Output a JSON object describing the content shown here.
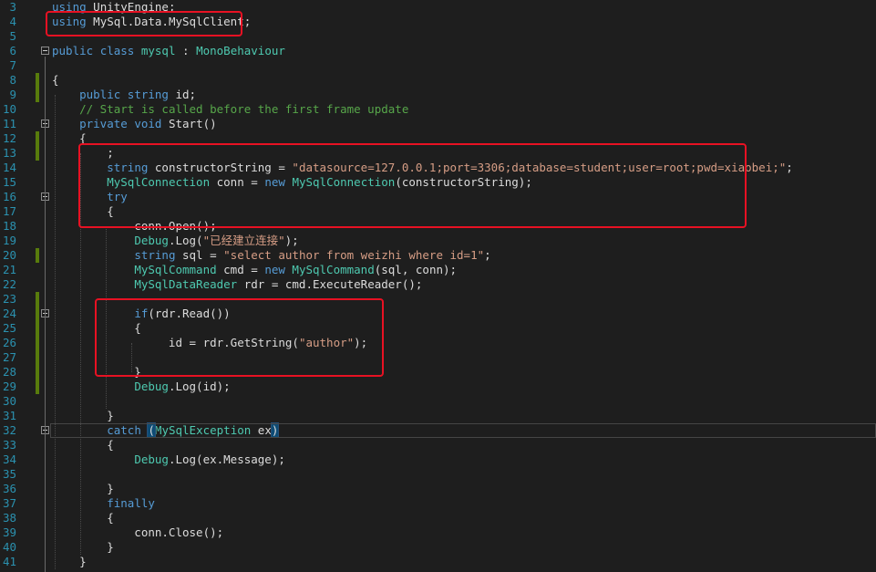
{
  "editor": {
    "lines": [
      {
        "n": "3",
        "segs": [
          {
            "c": "kw",
            "t": "using"
          },
          {
            "c": "txt",
            "t": " UnityEngine;"
          }
        ]
      },
      {
        "n": "4",
        "segs": [
          {
            "c": "kw",
            "t": "using"
          },
          {
            "c": "txt",
            "t": " MySql.Data.MySqlClient;"
          }
        ]
      },
      {
        "n": "5",
        "segs": []
      },
      {
        "n": "6",
        "segs": [
          {
            "c": "kw",
            "t": "public"
          },
          {
            "c": "txt",
            "t": " "
          },
          {
            "c": "kw",
            "t": "class"
          },
          {
            "c": "txt",
            "t": " "
          },
          {
            "c": "ty",
            "t": "mysql"
          },
          {
            "c": "txt",
            "t": " : "
          },
          {
            "c": "ty",
            "t": "MonoBehaviour"
          }
        ]
      },
      {
        "n": "7",
        "segs": []
      },
      {
        "n": "8",
        "segs": [
          {
            "c": "txt",
            "t": "{"
          }
        ]
      },
      {
        "n": "9",
        "segs": [
          {
            "c": "txt",
            "t": "    "
          },
          {
            "c": "kw",
            "t": "public"
          },
          {
            "c": "txt",
            "t": " "
          },
          {
            "c": "kw",
            "t": "string"
          },
          {
            "c": "txt",
            "t": " id;"
          }
        ]
      },
      {
        "n": "10",
        "segs": [
          {
            "c": "txt",
            "t": "    "
          },
          {
            "c": "cm",
            "t": "// Start is called before the first frame update"
          }
        ]
      },
      {
        "n": "11",
        "segs": [
          {
            "c": "txt",
            "t": "    "
          },
          {
            "c": "kw",
            "t": "private"
          },
          {
            "c": "txt",
            "t": " "
          },
          {
            "c": "kw",
            "t": "void"
          },
          {
            "c": "txt",
            "t": " Start()"
          }
        ]
      },
      {
        "n": "12",
        "segs": [
          {
            "c": "txt",
            "t": "    {"
          }
        ]
      },
      {
        "n": "13",
        "segs": [
          {
            "c": "txt",
            "t": "        ;"
          }
        ]
      },
      {
        "n": "14",
        "segs": [
          {
            "c": "txt",
            "t": "        "
          },
          {
            "c": "kw",
            "t": "string"
          },
          {
            "c": "txt",
            "t": " constructorString = "
          },
          {
            "c": "str",
            "t": "\"datasource=127.0.0.1;port=3306;database=student;user=root;pwd=xiaobei;\""
          },
          {
            "c": "txt",
            "t": ";"
          }
        ]
      },
      {
        "n": "15",
        "segs": [
          {
            "c": "txt",
            "t": "        "
          },
          {
            "c": "ty",
            "t": "MySqlConnection"
          },
          {
            "c": "txt",
            "t": " conn = "
          },
          {
            "c": "kw",
            "t": "new"
          },
          {
            "c": "txt",
            "t": " "
          },
          {
            "c": "ty",
            "t": "MySqlConnection"
          },
          {
            "c": "txt",
            "t": "(constructorString);"
          }
        ]
      },
      {
        "n": "16",
        "segs": [
          {
            "c": "txt",
            "t": "        "
          },
          {
            "c": "kw",
            "t": "try"
          }
        ]
      },
      {
        "n": "17",
        "segs": [
          {
            "c": "txt",
            "t": "        {"
          }
        ]
      },
      {
        "n": "18",
        "segs": [
          {
            "c": "txt",
            "t": "            conn.Open();"
          }
        ]
      },
      {
        "n": "19",
        "segs": [
          {
            "c": "txt",
            "t": "            "
          },
          {
            "c": "ty",
            "t": "Debug"
          },
          {
            "c": "txt",
            "t": ".Log("
          },
          {
            "c": "str",
            "t": "\"已经建立连接\""
          },
          {
            "c": "txt",
            "t": ");"
          }
        ]
      },
      {
        "n": "20",
        "segs": [
          {
            "c": "txt",
            "t": "            "
          },
          {
            "c": "kw",
            "t": "string"
          },
          {
            "c": "txt",
            "t": " sql = "
          },
          {
            "c": "str",
            "t": "\"select author from weizhi where id=1\""
          },
          {
            "c": "txt",
            "t": ";"
          }
        ]
      },
      {
        "n": "21",
        "segs": [
          {
            "c": "txt",
            "t": "            "
          },
          {
            "c": "ty",
            "t": "MySqlCommand"
          },
          {
            "c": "txt",
            "t": " cmd = "
          },
          {
            "c": "kw",
            "t": "new"
          },
          {
            "c": "txt",
            "t": " "
          },
          {
            "c": "ty",
            "t": "MySqlCommand"
          },
          {
            "c": "txt",
            "t": "(sql, conn);"
          }
        ]
      },
      {
        "n": "22",
        "segs": [
          {
            "c": "txt",
            "t": "            "
          },
          {
            "c": "ty",
            "t": "MySqlDataReader"
          },
          {
            "c": "txt",
            "t": " rdr = cmd.ExecuteReader();"
          }
        ]
      },
      {
        "n": "23",
        "segs": []
      },
      {
        "n": "24",
        "segs": [
          {
            "c": "txt",
            "t": "            "
          },
          {
            "c": "kw",
            "t": "if"
          },
          {
            "c": "txt",
            "t": "(rdr.Read())"
          }
        ]
      },
      {
        "n": "25",
        "segs": [
          {
            "c": "txt",
            "t": "            {"
          }
        ]
      },
      {
        "n": "26",
        "segs": [
          {
            "c": "txt",
            "t": "                 id = rdr.GetString("
          },
          {
            "c": "str",
            "t": "\"author\""
          },
          {
            "c": "txt",
            "t": ");"
          }
        ]
      },
      {
        "n": "27",
        "segs": []
      },
      {
        "n": "28",
        "segs": [
          {
            "c": "txt",
            "t": "            }"
          }
        ]
      },
      {
        "n": "29",
        "segs": [
          {
            "c": "txt",
            "t": "            "
          },
          {
            "c": "ty",
            "t": "Debug"
          },
          {
            "c": "txt",
            "t": ".Log(id);"
          }
        ]
      },
      {
        "n": "30",
        "segs": []
      },
      {
        "n": "31",
        "segs": [
          {
            "c": "txt",
            "t": "        }"
          }
        ]
      },
      {
        "n": "32",
        "segs": [
          {
            "c": "txt",
            "t": "        "
          },
          {
            "c": "kw",
            "t": "catch"
          },
          {
            "c": "txt",
            "t": " "
          },
          {
            "c": "hl",
            "t": "("
          },
          {
            "c": "ty",
            "t": "MySqlException"
          },
          {
            "c": "txt",
            "t": " ex"
          },
          {
            "c": "hl",
            "t": ")"
          }
        ]
      },
      {
        "n": "33",
        "segs": [
          {
            "c": "txt",
            "t": "        {"
          }
        ]
      },
      {
        "n": "34",
        "segs": [
          {
            "c": "txt",
            "t": "            "
          },
          {
            "c": "ty",
            "t": "Debug"
          },
          {
            "c": "txt",
            "t": ".Log(ex.Message);"
          }
        ]
      },
      {
        "n": "35",
        "segs": []
      },
      {
        "n": "36",
        "segs": [
          {
            "c": "txt",
            "t": "        }"
          }
        ]
      },
      {
        "n": "37",
        "segs": [
          {
            "c": "txt",
            "t": "        "
          },
          {
            "c": "kw",
            "t": "finally"
          }
        ]
      },
      {
        "n": "38",
        "segs": [
          {
            "c": "txt",
            "t": "        {"
          }
        ]
      },
      {
        "n": "39",
        "segs": [
          {
            "c": "txt",
            "t": "            conn.Close();"
          }
        ]
      },
      {
        "n": "40",
        "segs": [
          {
            "c": "txt",
            "t": "        }"
          }
        ]
      },
      {
        "n": "41",
        "segs": [
          {
            "c": "txt",
            "t": "    }"
          }
        ]
      }
    ],
    "modified_lines": [
      "8",
      "9",
      "12",
      "13",
      "20",
      "23",
      "24",
      "25",
      "26",
      "27",
      "28",
      "29"
    ],
    "fold_lines": [
      "6",
      "11",
      "16",
      "24",
      "32"
    ]
  },
  "colors": {
    "background": "#1e1e1e",
    "line_number": "#2b91af",
    "keyword": "#569cd6",
    "type": "#4ec9b0",
    "string": "#d69d85",
    "comment": "#57a64a",
    "annotation_box": "#e81123",
    "modified_marker": "#587c0c"
  }
}
